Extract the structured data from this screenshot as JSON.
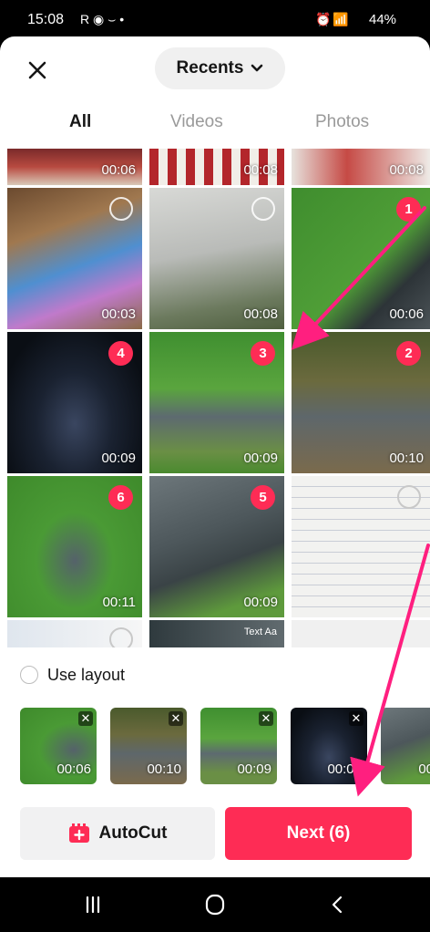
{
  "status_bar": {
    "time": "15:08",
    "left_icons": "R ◉ ⌣ •",
    "battery": "44%"
  },
  "header": {
    "title": "Recents",
    "close_icon": "close-icon",
    "chevron_icon": "chevron-down-icon"
  },
  "tabs": [
    {
      "label": "All",
      "active": true
    },
    {
      "label": "Videos",
      "active": false
    },
    {
      "label": "Photos",
      "active": false
    }
  ],
  "grid": {
    "top_row": [
      {
        "duration": "00:06"
      },
      {
        "duration": "00:08"
      },
      {
        "duration": "00:08"
      }
    ],
    "rows": [
      [
        {
          "duration": "00:03",
          "selection": ""
        },
        {
          "duration": "00:08",
          "selection": ""
        },
        {
          "duration": "00:06",
          "selection": "1"
        }
      ],
      [
        {
          "duration": "00:09",
          "selection": "4"
        },
        {
          "duration": "00:09",
          "selection": "3"
        },
        {
          "duration": "00:10",
          "selection": "2"
        }
      ],
      [
        {
          "duration": "00:11",
          "selection": "6"
        },
        {
          "duration": "00:09",
          "selection": "5"
        },
        {
          "duration": "",
          "selection": ""
        }
      ]
    ],
    "bottom_row_text": "Text Aa"
  },
  "use_layout": {
    "label": "Use layout",
    "checked": false
  },
  "selected_tray": [
    {
      "duration": "00:06"
    },
    {
      "duration": "00:10"
    },
    {
      "duration": "00:09"
    },
    {
      "duration": "00:09"
    },
    {
      "duration": "00"
    }
  ],
  "actions": {
    "autocut_label": "AutoCut",
    "next_label": "Next (6)"
  },
  "colors": {
    "accent": "#fe2c55",
    "annotation": "#ff1f7f"
  }
}
